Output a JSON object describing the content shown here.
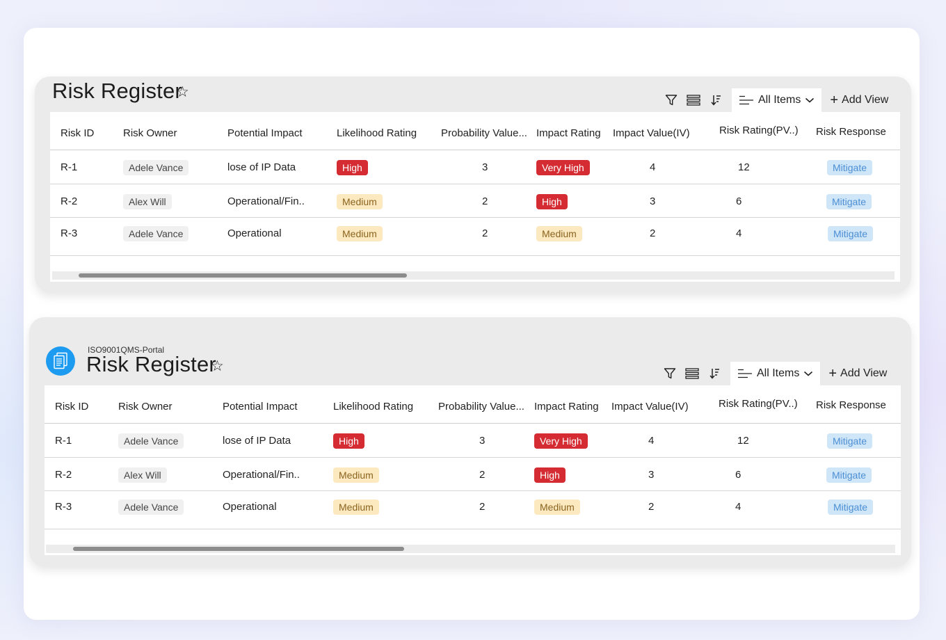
{
  "panels": [
    {
      "site_label": "",
      "title": "Risk Register",
      "toolbar": {
        "view": "All Items",
        "add_view": "Add View"
      },
      "columns": [
        "Risk ID",
        "Risk Owner",
        "Potential Impact",
        "Likelihood Rating",
        "Probability Value...",
        "Impact Rating",
        "Impact Value(IV)",
        "Risk Rating(PV..)",
        "Risk Response"
      ],
      "rows": [
        {
          "id": "R-1",
          "owner": "Adele Vance",
          "impact": "lose of IP Data",
          "likelihood": "High",
          "prob": "3",
          "impact_rating": "Very High",
          "impact_value": "4",
          "rating": "12",
          "response": "Mitigate"
        },
        {
          "id": "R-2",
          "owner": "Alex Will",
          "impact": "Operational/Fin..",
          "likelihood": "Medium",
          "prob": "2",
          "impact_rating": "High",
          "impact_value": "3",
          "rating": "6",
          "response": "Mitigate"
        },
        {
          "id": "R-3",
          "owner": "Adele Vance",
          "impact": "Operational",
          "likelihood": "Medium",
          "prob": "2",
          "impact_rating": "Medium",
          "impact_value": "2",
          "rating": "4",
          "response": "Mitigate"
        }
      ],
      "scroll_fraction": 0.39
    },
    {
      "site_label": "ISO9001QMS-Portal",
      "title": "Risk Register",
      "toolbar": {
        "view": "All Items",
        "add_view": "Add View"
      },
      "columns": [
        "Risk ID",
        "Risk Owner",
        "Potential Impact",
        "Likelihood Rating",
        "Probability Value...",
        "Impact Rating",
        "Impact Value(IV)",
        "Risk Rating(PV..)",
        "Risk Response"
      ],
      "rows": [
        {
          "id": "R-1",
          "owner": "Adele Vance",
          "impact": "lose of IP Data",
          "likelihood": "High",
          "prob": "3",
          "impact_rating": "Very High",
          "impact_value": "4",
          "rating": "12",
          "response": "Mitigate"
        },
        {
          "id": "R-2",
          "owner": "Alex Will",
          "impact": "Operational/Fin..",
          "likelihood": "Medium",
          "prob": "2",
          "impact_rating": "High",
          "impact_value": "3",
          "rating": "6",
          "response": "Mitigate"
        },
        {
          "id": "R-3",
          "owner": "Adele Vance",
          "impact": "Operational",
          "likelihood": "Medium",
          "prob": "2",
          "impact_rating": "Medium",
          "impact_value": "2",
          "rating": "4",
          "response": "Mitigate"
        }
      ],
      "scroll_fraction": 0.39
    }
  ],
  "colors": {
    "rating_high": "#d52b32",
    "rating_medium_bg": "#fde9bf",
    "response_bg": "#cfe5f8",
    "site_icon": "#1d9bf0"
  },
  "icons": [
    "star-icon",
    "filter-icon",
    "list-view-icon",
    "sort-icon",
    "view-menu-icon",
    "chevron-down-icon",
    "plus-icon",
    "site-logo-icon"
  ]
}
